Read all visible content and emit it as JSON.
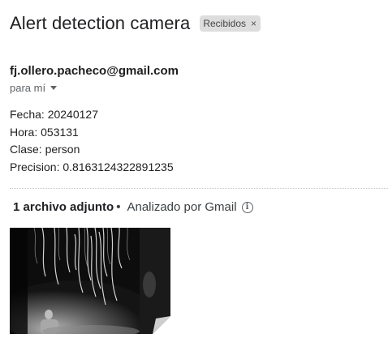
{
  "subject": "Alert detection camera",
  "label_chip": {
    "text": "Recibidos",
    "remove_glyph": "×"
  },
  "sender": "fj.ollero.pacheco@gmail.com",
  "to": "para mí",
  "body": [
    "Fecha: 20240127",
    "Hora: 053131",
    "Clase: person",
    "Precision: 0.8163124322891235"
  ],
  "attachments": {
    "count_label": "1 archivo adjunto",
    "separator": "•",
    "scanned_label": "Analizado por Gmail",
    "info_icon": "info-icon"
  }
}
